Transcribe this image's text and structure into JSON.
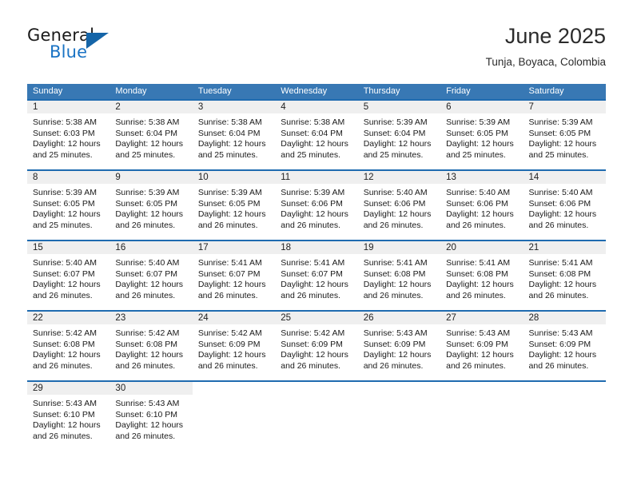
{
  "brand": {
    "name_top": "General",
    "name_bottom": "Blue",
    "triangle_icon": "triangle-icon",
    "color_dark": "#1a1a1a",
    "color_blue": "#1a73c4",
    "color_triangle": "#1565a8"
  },
  "header": {
    "title": "June 2025",
    "location": "Tunja, Boyaca, Colombia"
  },
  "theme": {
    "header_bg": "#3878b4",
    "header_text": "#ffffff",
    "row_divider": "#1f6bb0",
    "day_band_bg": "#efefef",
    "cell_bg": "#ffffff",
    "text": "#1a1a1a"
  },
  "weekdays": [
    "Sunday",
    "Monday",
    "Tuesday",
    "Wednesday",
    "Thursday",
    "Friday",
    "Saturday"
  ],
  "weeks": [
    {
      "days": [
        {
          "number": "1",
          "sunrise": "Sunrise: 5:38 AM",
          "sunset": "Sunset: 6:03 PM",
          "daylight1": "Daylight: 12 hours",
          "daylight2": "and 25 minutes."
        },
        {
          "number": "2",
          "sunrise": "Sunrise: 5:38 AM",
          "sunset": "Sunset: 6:04 PM",
          "daylight1": "Daylight: 12 hours",
          "daylight2": "and 25 minutes."
        },
        {
          "number": "3",
          "sunrise": "Sunrise: 5:38 AM",
          "sunset": "Sunset: 6:04 PM",
          "daylight1": "Daylight: 12 hours",
          "daylight2": "and 25 minutes."
        },
        {
          "number": "4",
          "sunrise": "Sunrise: 5:38 AM",
          "sunset": "Sunset: 6:04 PM",
          "daylight1": "Daylight: 12 hours",
          "daylight2": "and 25 minutes."
        },
        {
          "number": "5",
          "sunrise": "Sunrise: 5:39 AM",
          "sunset": "Sunset: 6:04 PM",
          "daylight1": "Daylight: 12 hours",
          "daylight2": "and 25 minutes."
        },
        {
          "number": "6",
          "sunrise": "Sunrise: 5:39 AM",
          "sunset": "Sunset: 6:05 PM",
          "daylight1": "Daylight: 12 hours",
          "daylight2": "and 25 minutes."
        },
        {
          "number": "7",
          "sunrise": "Sunrise: 5:39 AM",
          "sunset": "Sunset: 6:05 PM",
          "daylight1": "Daylight: 12 hours",
          "daylight2": "and 25 minutes."
        }
      ]
    },
    {
      "days": [
        {
          "number": "8",
          "sunrise": "Sunrise: 5:39 AM",
          "sunset": "Sunset: 6:05 PM",
          "daylight1": "Daylight: 12 hours",
          "daylight2": "and 25 minutes."
        },
        {
          "number": "9",
          "sunrise": "Sunrise: 5:39 AM",
          "sunset": "Sunset: 6:05 PM",
          "daylight1": "Daylight: 12 hours",
          "daylight2": "and 26 minutes."
        },
        {
          "number": "10",
          "sunrise": "Sunrise: 5:39 AM",
          "sunset": "Sunset: 6:05 PM",
          "daylight1": "Daylight: 12 hours",
          "daylight2": "and 26 minutes."
        },
        {
          "number": "11",
          "sunrise": "Sunrise: 5:39 AM",
          "sunset": "Sunset: 6:06 PM",
          "daylight1": "Daylight: 12 hours",
          "daylight2": "and 26 minutes."
        },
        {
          "number": "12",
          "sunrise": "Sunrise: 5:40 AM",
          "sunset": "Sunset: 6:06 PM",
          "daylight1": "Daylight: 12 hours",
          "daylight2": "and 26 minutes."
        },
        {
          "number": "13",
          "sunrise": "Sunrise: 5:40 AM",
          "sunset": "Sunset: 6:06 PM",
          "daylight1": "Daylight: 12 hours",
          "daylight2": "and 26 minutes."
        },
        {
          "number": "14",
          "sunrise": "Sunrise: 5:40 AM",
          "sunset": "Sunset: 6:06 PM",
          "daylight1": "Daylight: 12 hours",
          "daylight2": "and 26 minutes."
        }
      ]
    },
    {
      "days": [
        {
          "number": "15",
          "sunrise": "Sunrise: 5:40 AM",
          "sunset": "Sunset: 6:07 PM",
          "daylight1": "Daylight: 12 hours",
          "daylight2": "and 26 minutes."
        },
        {
          "number": "16",
          "sunrise": "Sunrise: 5:40 AM",
          "sunset": "Sunset: 6:07 PM",
          "daylight1": "Daylight: 12 hours",
          "daylight2": "and 26 minutes."
        },
        {
          "number": "17",
          "sunrise": "Sunrise: 5:41 AM",
          "sunset": "Sunset: 6:07 PM",
          "daylight1": "Daylight: 12 hours",
          "daylight2": "and 26 minutes."
        },
        {
          "number": "18",
          "sunrise": "Sunrise: 5:41 AM",
          "sunset": "Sunset: 6:07 PM",
          "daylight1": "Daylight: 12 hours",
          "daylight2": "and 26 minutes."
        },
        {
          "number": "19",
          "sunrise": "Sunrise: 5:41 AM",
          "sunset": "Sunset: 6:08 PM",
          "daylight1": "Daylight: 12 hours",
          "daylight2": "and 26 minutes."
        },
        {
          "number": "20",
          "sunrise": "Sunrise: 5:41 AM",
          "sunset": "Sunset: 6:08 PM",
          "daylight1": "Daylight: 12 hours",
          "daylight2": "and 26 minutes."
        },
        {
          "number": "21",
          "sunrise": "Sunrise: 5:41 AM",
          "sunset": "Sunset: 6:08 PM",
          "daylight1": "Daylight: 12 hours",
          "daylight2": "and 26 minutes."
        }
      ]
    },
    {
      "days": [
        {
          "number": "22",
          "sunrise": "Sunrise: 5:42 AM",
          "sunset": "Sunset: 6:08 PM",
          "daylight1": "Daylight: 12 hours",
          "daylight2": "and 26 minutes."
        },
        {
          "number": "23",
          "sunrise": "Sunrise: 5:42 AM",
          "sunset": "Sunset: 6:08 PM",
          "daylight1": "Daylight: 12 hours",
          "daylight2": "and 26 minutes."
        },
        {
          "number": "24",
          "sunrise": "Sunrise: 5:42 AM",
          "sunset": "Sunset: 6:09 PM",
          "daylight1": "Daylight: 12 hours",
          "daylight2": "and 26 minutes."
        },
        {
          "number": "25",
          "sunrise": "Sunrise: 5:42 AM",
          "sunset": "Sunset: 6:09 PM",
          "daylight1": "Daylight: 12 hours",
          "daylight2": "and 26 minutes."
        },
        {
          "number": "26",
          "sunrise": "Sunrise: 5:43 AM",
          "sunset": "Sunset: 6:09 PM",
          "daylight1": "Daylight: 12 hours",
          "daylight2": "and 26 minutes."
        },
        {
          "number": "27",
          "sunrise": "Sunrise: 5:43 AM",
          "sunset": "Sunset: 6:09 PM",
          "daylight1": "Daylight: 12 hours",
          "daylight2": "and 26 minutes."
        },
        {
          "number": "28",
          "sunrise": "Sunrise: 5:43 AM",
          "sunset": "Sunset: 6:09 PM",
          "daylight1": "Daylight: 12 hours",
          "daylight2": "and 26 minutes."
        }
      ]
    },
    {
      "days": [
        {
          "number": "29",
          "sunrise": "Sunrise: 5:43 AM",
          "sunset": "Sunset: 6:10 PM",
          "daylight1": "Daylight: 12 hours",
          "daylight2": "and 26 minutes."
        },
        {
          "number": "30",
          "sunrise": "Sunrise: 5:43 AM",
          "sunset": "Sunset: 6:10 PM",
          "daylight1": "Daylight: 12 hours",
          "daylight2": "and 26 minutes."
        },
        {
          "number": "",
          "sunrise": "",
          "sunset": "",
          "daylight1": "",
          "daylight2": ""
        },
        {
          "number": "",
          "sunrise": "",
          "sunset": "",
          "daylight1": "",
          "daylight2": ""
        },
        {
          "number": "",
          "sunrise": "",
          "sunset": "",
          "daylight1": "",
          "daylight2": ""
        },
        {
          "number": "",
          "sunrise": "",
          "sunset": "",
          "daylight1": "",
          "daylight2": ""
        },
        {
          "number": "",
          "sunrise": "",
          "sunset": "",
          "daylight1": "",
          "daylight2": ""
        }
      ]
    }
  ]
}
